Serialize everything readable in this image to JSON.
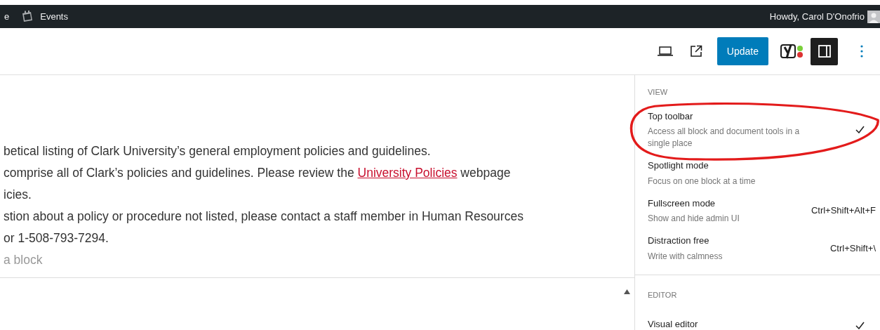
{
  "admin_bar": {
    "left_fragment": "e",
    "events": "Events",
    "greeting": "Howdy, Carol D'Onofrio"
  },
  "header": {
    "update_button": "Update",
    "sidebar_toggle": {
      "on": true
    }
  },
  "content": {
    "lines": [
      {
        "text": "betical listing of Clark University’s general employment policies and guidelines."
      },
      {
        "text": "comprise all of Clark’s policies and guidelines. Please review the ",
        "link": "University Policies",
        "after": " webpage"
      },
      {
        "text": "icies."
      },
      {
        "text": "stion about a policy or procedure not listed, please contact a staff member in Human Resources"
      },
      {
        "text": "or 1-508-793-7294."
      }
    ],
    "placeholder": "a block"
  },
  "menu": {
    "sections": [
      {
        "title": "VIEW",
        "items": [
          {
            "label": "Top toolbar",
            "description": "Access all block and document tools in a single place",
            "checked": true
          },
          {
            "label": "Spotlight mode",
            "description": "Focus on one block at a time",
            "checked": false
          },
          {
            "label": "Fullscreen mode",
            "description": "Show and hide admin UI",
            "shortcut": "Ctrl+Shift+Alt+F",
            "checked": false
          },
          {
            "label": "Distraction free",
            "description": "Write with calmness",
            "shortcut": "Ctrl+Shift+\\",
            "checked": false
          }
        ]
      },
      {
        "title": "EDITOR",
        "items": [
          {
            "label": "Visual editor",
            "checked": true
          }
        ]
      }
    ]
  }
}
